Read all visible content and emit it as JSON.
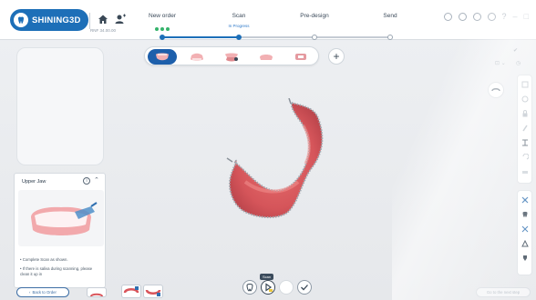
{
  "brand": {
    "name": "SHINING3D"
  },
  "header": {
    "order_id": "RNF 34.00.00",
    "steps": [
      {
        "label": "New order",
        "sub": ""
      },
      {
        "label": "Scan",
        "sub": "In Progress"
      },
      {
        "label": "Pre-design",
        "sub": ""
      },
      {
        "label": "Send",
        "sub": ""
      }
    ],
    "help_text": "?"
  },
  "left_panel": {
    "jaw_title": "Upper Jaw",
    "instructions": [
      "• Complete Scan as shown.",
      "• If there is saliva during scanning, please clean it up in"
    ],
    "back_label": "Back to Order"
  },
  "bottom": {
    "tooltip": "Scan",
    "next_label": "Go to the next step"
  },
  "colors": {
    "accent": "#1d6fb8",
    "scan": "#d9545a",
    "green": "#34b36b"
  }
}
